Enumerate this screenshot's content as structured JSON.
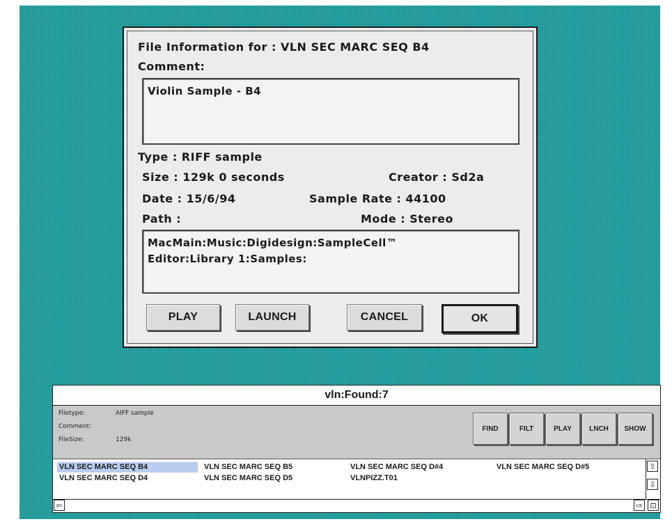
{
  "dialog": {
    "title": "File Information for : VLN SEC MARC SEQ B4",
    "comment_label": "Comment:",
    "comment_value": "Violin Sample - B4",
    "type": "Type : RIFF sample",
    "size": "Size : 129k 0 seconds",
    "creator": "Creator : Sd2a",
    "date": "Date : 15/6/94",
    "sample_rate": "Sample Rate : 44100",
    "path_label": "Path :",
    "mode": "Mode : Stereo",
    "path_line1": "MacMain:Music:Digidesign:SampleCell™",
    "path_line2": "Editor:Library 1:Samples:",
    "buttons": {
      "play": "PLAY",
      "launch": "LAUNCH",
      "cancel": "CANCEL",
      "ok": "OK"
    }
  },
  "finder": {
    "title": "vln:Found:7",
    "info": {
      "filetype_label": "Filetype:",
      "filetype_value": "AIFF sample",
      "comment_label": "Comment:",
      "filesize_label": "FileSize:",
      "filesize_value": "129k"
    },
    "toolbar": {
      "find": "FIND",
      "filt": "FILT",
      "play": "PLAY",
      "lnch": "LNCH",
      "show": "SHOW"
    },
    "files": [
      "VLN SEC MARC SEQ B4",
      "VLN SEC MARC SEQ B5",
      "VLN SEC MARC SEQ D#4",
      "VLN SEC MARC SEQ D#5",
      "VLN SEC MARC SEQ D4",
      "VLN SEC MARC SEQ D5",
      "VLNPIZZ.T01"
    ],
    "selected_file": "VLN SEC MARC SEQ B4"
  },
  "colors": {
    "desktop": "#2aa9a8",
    "selection": "#b9cdf0"
  }
}
